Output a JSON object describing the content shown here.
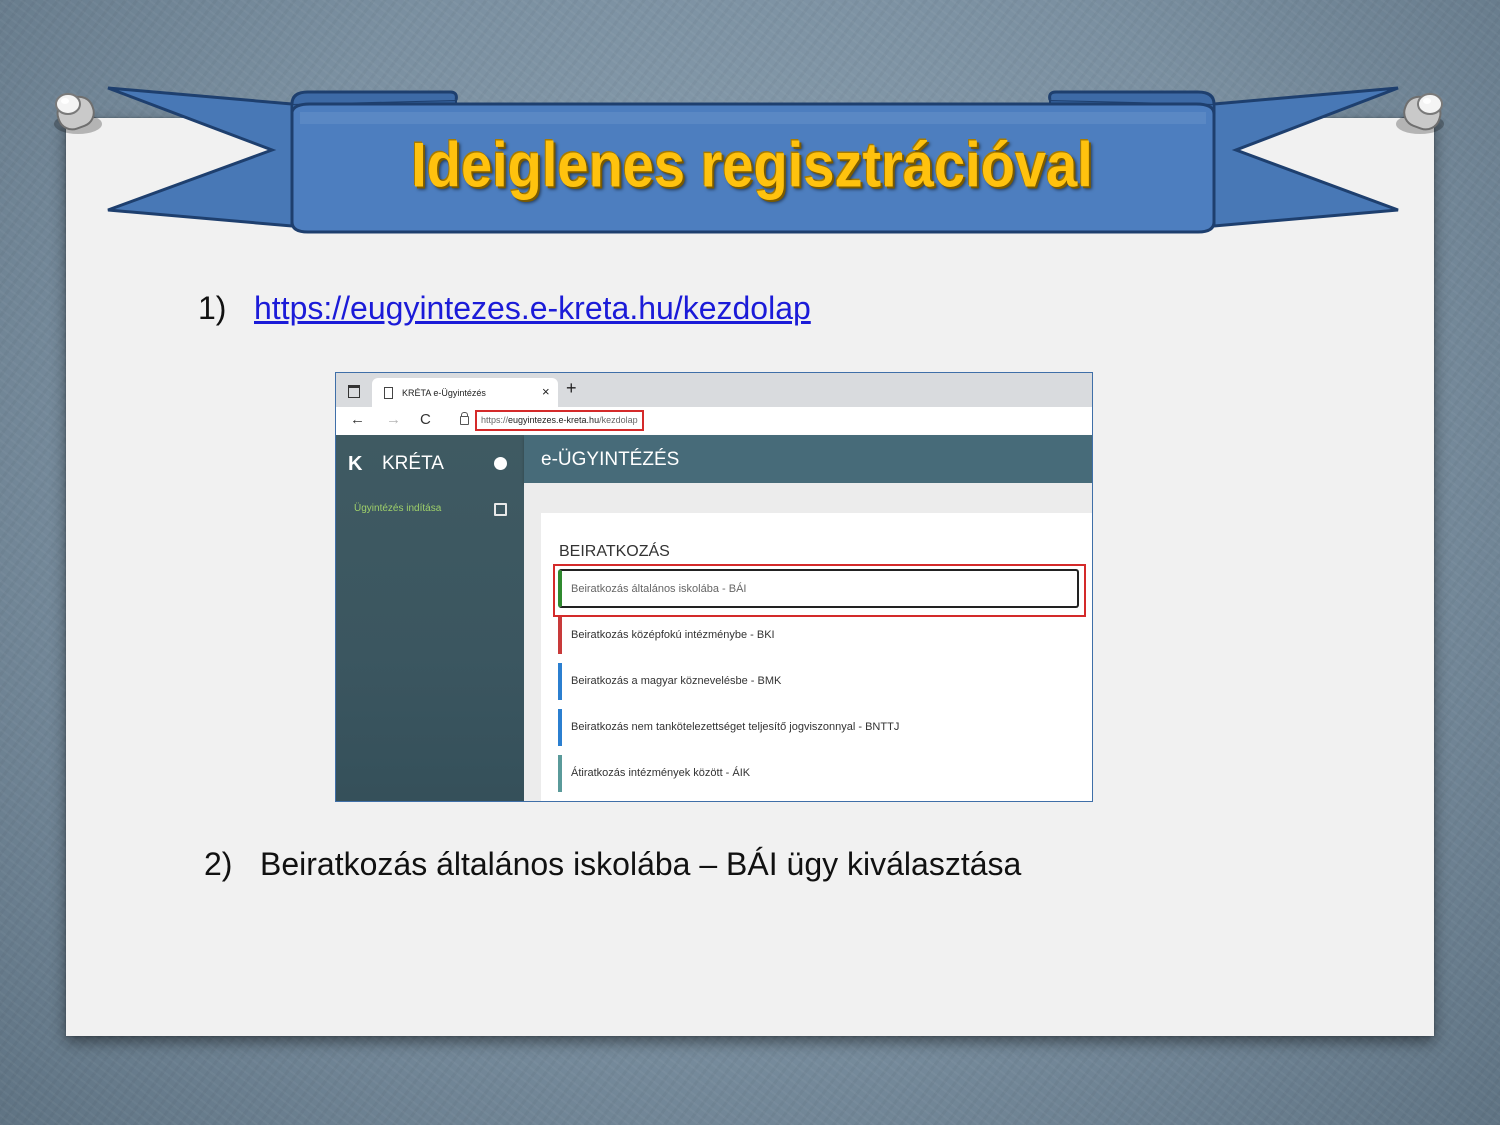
{
  "slide": {
    "title": "Ideiglenes regisztrációval",
    "step1": {
      "number": "1)",
      "link_text": "https://eugyintezes.e-kreta.hu/kezdolap"
    },
    "step2": {
      "number": "2)",
      "text": "Beiratkozás általános iskolába – BÁI ügy kiválasztása"
    }
  },
  "browser": {
    "tab_label": "KRÉTA e-Ügyintézés",
    "tab_close": "×",
    "new_tab": "+",
    "nav_back": "←",
    "nav_forward": "→",
    "nav_reload": "C",
    "url_prefix": "https://",
    "url_host": "eugyintezes.e-kreta.hu",
    "url_path": "/kezdolap"
  },
  "app": {
    "logo_glyph": "K",
    "brand": "KRÉTA",
    "sidebar_item": "Ügyintézés indítása",
    "header_title": "e-ÜGYINTÉZÉS",
    "section_title": "BEIRATKOZÁS",
    "items": [
      {
        "label": "Beiratkozás általános iskolába - BÁI",
        "color": "#2f8a2f",
        "selected": true
      },
      {
        "label": "Beiratkozás középfokú intézménybe - BKI",
        "color": "#c83a3a"
      },
      {
        "label": "Beiratkozás a magyar köznevelésbe - BMK",
        "color": "#2b7fd0"
      },
      {
        "label": "Beiratkozás nem tankötelezettséget teljesítő jogviszonnyal - BNTTJ",
        "color": "#2b7fd0"
      },
      {
        "label": "Átiratkozás intézmények között - ÁIK",
        "color": "#5a9a9a"
      }
    ]
  },
  "colors": {
    "title_gold": "#ffc20e",
    "ribbon_blue": "#4a7ab8",
    "highlight_red": "#d42a2a",
    "sidebar_active": "#9fd06a"
  }
}
